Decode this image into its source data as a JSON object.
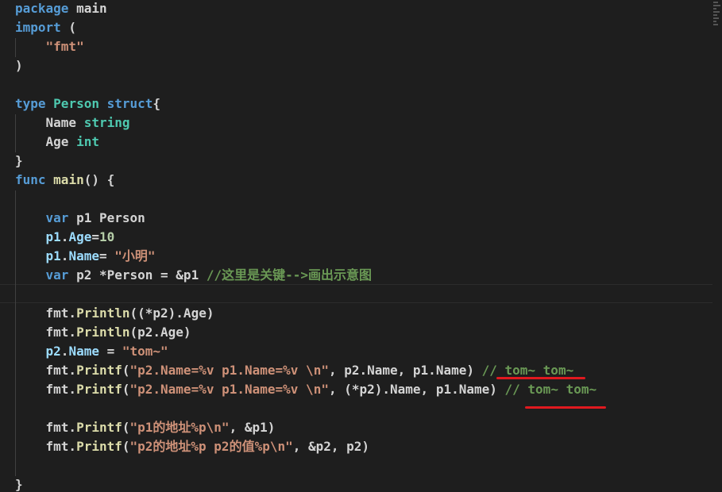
{
  "editor": {
    "colors": {
      "keyword": "#569cd6",
      "type": "#4ec9b0",
      "string": "#ce9178",
      "number": "#b5cea8",
      "comment": "#6a9955",
      "function": "#dcdcaa",
      "variable": "#9cdcfe",
      "plain": "#d4d4d4",
      "annotation": "#e0191f"
    },
    "lines": [
      [
        {
          "t": "package",
          "c": "keyword"
        },
        {
          "t": " main",
          "c": "plain"
        }
      ],
      [
        {
          "t": "import",
          "c": "keyword"
        },
        {
          "t": " (",
          "c": "plain"
        }
      ],
      [
        {
          "t": "    ",
          "c": "plain"
        },
        {
          "t": "\"fmt\"",
          "c": "string"
        }
      ],
      [
        {
          "t": ")",
          "c": "plain"
        }
      ],
      [],
      [
        {
          "t": "type",
          "c": "keyword"
        },
        {
          "t": " ",
          "c": "plain"
        },
        {
          "t": "Person",
          "c": "type"
        },
        {
          "t": " ",
          "c": "plain"
        },
        {
          "t": "struct",
          "c": "keyword"
        },
        {
          "t": "{",
          "c": "plain"
        }
      ],
      [
        {
          "t": "    Name ",
          "c": "plain"
        },
        {
          "t": "string",
          "c": "type"
        }
      ],
      [
        {
          "t": "    Age ",
          "c": "plain"
        },
        {
          "t": "int",
          "c": "type"
        }
      ],
      [
        {
          "t": "}",
          "c": "plain"
        }
      ],
      [
        {
          "t": "func",
          "c": "keyword"
        },
        {
          "t": " ",
          "c": "plain"
        },
        {
          "t": "main",
          "c": "function"
        },
        {
          "t": "() {",
          "c": "plain"
        }
      ],
      [],
      [
        {
          "t": "    ",
          "c": "plain"
        },
        {
          "t": "var",
          "c": "keyword"
        },
        {
          "t": " p1 Person",
          "c": "plain"
        }
      ],
      [
        {
          "t": "    ",
          "c": "plain"
        },
        {
          "t": "p1",
          "c": "variable"
        },
        {
          "t": ".",
          "c": "plain"
        },
        {
          "t": "Age",
          "c": "variable"
        },
        {
          "t": "=",
          "c": "plain"
        },
        {
          "t": "10",
          "c": "number"
        }
      ],
      [
        {
          "t": "    ",
          "c": "plain"
        },
        {
          "t": "p1",
          "c": "variable"
        },
        {
          "t": ".",
          "c": "plain"
        },
        {
          "t": "Name",
          "c": "variable"
        },
        {
          "t": "= ",
          "c": "plain"
        },
        {
          "t": "\"小明\"",
          "c": "string"
        }
      ],
      [
        {
          "t": "    ",
          "c": "plain"
        },
        {
          "t": "var",
          "c": "keyword"
        },
        {
          "t": " p2 *Person = &p1 ",
          "c": "plain"
        },
        {
          "t": "//这里是关键-->画出示意图",
          "c": "comment"
        }
      ],
      [],
      [
        {
          "t": "    fmt.",
          "c": "plain"
        },
        {
          "t": "Println",
          "c": "function"
        },
        {
          "t": "((*p2).Age)",
          "c": "plain"
        }
      ],
      [
        {
          "t": "    fmt.",
          "c": "plain"
        },
        {
          "t": "Println",
          "c": "function"
        },
        {
          "t": "(p2.Age)",
          "c": "plain"
        }
      ],
      [
        {
          "t": "    ",
          "c": "plain"
        },
        {
          "t": "p2",
          "c": "variable"
        },
        {
          "t": ".",
          "c": "plain"
        },
        {
          "t": "Name",
          "c": "variable"
        },
        {
          "t": " = ",
          "c": "plain"
        },
        {
          "t": "\"tom~\"",
          "c": "string"
        }
      ],
      [
        {
          "t": "    fmt.",
          "c": "plain"
        },
        {
          "t": "Printf",
          "c": "function"
        },
        {
          "t": "(",
          "c": "plain"
        },
        {
          "t": "\"p2.Name=%v p1.Name=%v \\n\"",
          "c": "string"
        },
        {
          "t": ", p2.Name, p1.Name) ",
          "c": "plain"
        },
        {
          "t": "// tom~ tom~",
          "c": "comment"
        }
      ],
      [
        {
          "t": "    fmt.",
          "c": "plain"
        },
        {
          "t": "Printf",
          "c": "function"
        },
        {
          "t": "(",
          "c": "plain"
        },
        {
          "t": "\"p2.Name=%v p1.Name=%v \\n\"",
          "c": "string"
        },
        {
          "t": ", (*p2).Name, p1.Name) ",
          "c": "plain"
        },
        {
          "t": "// tom~ tom~",
          "c": "comment"
        }
      ],
      [],
      [
        {
          "t": "    fmt.",
          "c": "plain"
        },
        {
          "t": "Printf",
          "c": "function"
        },
        {
          "t": "(",
          "c": "plain"
        },
        {
          "t": "\"p1的地址%p\\n\"",
          "c": "string"
        },
        {
          "t": ", &p1)",
          "c": "plain"
        }
      ],
      [
        {
          "t": "    fmt.",
          "c": "plain"
        },
        {
          "t": "Printf",
          "c": "function"
        },
        {
          "t": "(",
          "c": "plain"
        },
        {
          "t": "\"p2的地址%p p2的值%p\\n\"",
          "c": "string"
        },
        {
          "t": ", &p2, p2)",
          "c": "plain"
        }
      ],
      [],
      [
        {
          "t": "}",
          "c": "plain"
        }
      ]
    ]
  }
}
